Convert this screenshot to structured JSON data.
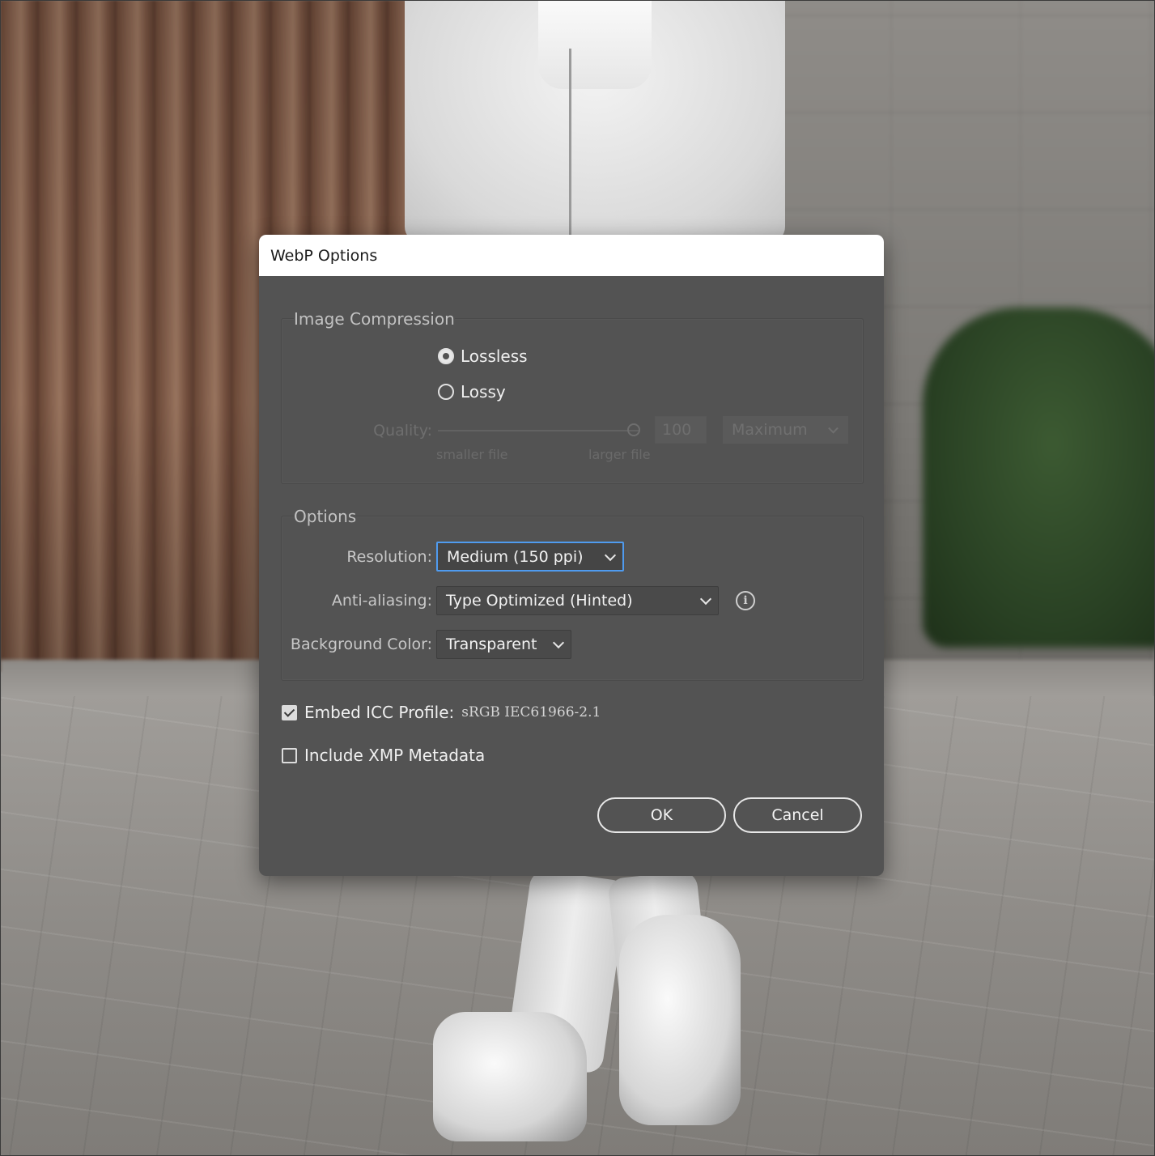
{
  "dialog": {
    "title": "WebP Options",
    "image_compression": {
      "title": "Image Compression",
      "options": [
        {
          "label": "Lossless",
          "selected": true
        },
        {
          "label": "Lossy",
          "selected": false
        }
      ],
      "quality": {
        "label": "Quality:",
        "value": "100",
        "level": 100,
        "min_label": "smaller file",
        "max_label": "larger file",
        "preset": "Maximum",
        "enabled": false
      }
    },
    "options": {
      "title": "Options",
      "resolution": {
        "label": "Resolution:",
        "value": "Medium (150 ppi)"
      },
      "anti_aliasing": {
        "label": "Anti-aliasing:",
        "value": "Type Optimized (Hinted)",
        "info_icon": "info-icon"
      },
      "background_color": {
        "label": "Background Color:",
        "value": "Transparent"
      }
    },
    "embed_icc": {
      "label": "Embed ICC Profile:",
      "profile": "sRGB IEC61966-2.1",
      "checked": true
    },
    "include_xmp": {
      "label": "Include XMP Metadata",
      "checked": false
    },
    "buttons": {
      "ok": "OK",
      "cancel": "Cancel"
    }
  },
  "colors": {
    "dialog_bg": "#535353",
    "titlebar_bg": "#ffffff",
    "focus_ring": "#4f9bef"
  }
}
